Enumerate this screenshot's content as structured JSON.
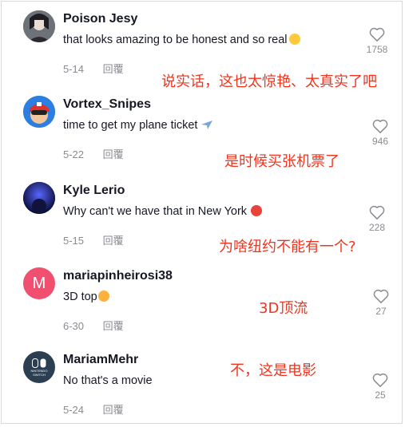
{
  "comments": [
    {
      "username": "Poison Jesy",
      "text": "that looks amazing to be honest and so real",
      "date": "5-14",
      "reply_label": "回覆",
      "likes": "1758",
      "translation": "说实话，这也太惊艳、太真实了吧",
      "emoji": "relieved-face-emoji"
    },
    {
      "username": "Vortex_Snipes",
      "text": "time to get my plane ticket",
      "date": "5-22",
      "reply_label": "回覆",
      "likes": "946",
      "translation": "是时候买张机票了",
      "emoji": "airplane-emoji"
    },
    {
      "username": "Kyle Lerio",
      "text": "Why can't we have that in New York",
      "date": "5-15",
      "reply_label": "回覆",
      "likes": "228",
      "translation": "为啥纽约不能有一个?",
      "emoji": "angry-face-emoji"
    },
    {
      "username": "mariapinheirosi38",
      "text": "3D top",
      "date": "6-30",
      "reply_label": "回覆",
      "likes": "27",
      "translation": "3D顶流",
      "avatar_letter": "M",
      "emoji": "smiling-face-with-hearts-emoji"
    },
    {
      "username": "MariamMehr",
      "text": "No that's a movie",
      "date": "5-24",
      "reply_label": "回覆",
      "likes": "25",
      "translation": "不，这是电影",
      "avatar_text": "NINTENDO SWITCH"
    }
  ],
  "colors": {
    "translation": "#f0341e",
    "username": "#161823",
    "meta": "#8a8b91",
    "avatar_m": "#f04f70",
    "avatar_switch": "#2b3e52"
  }
}
